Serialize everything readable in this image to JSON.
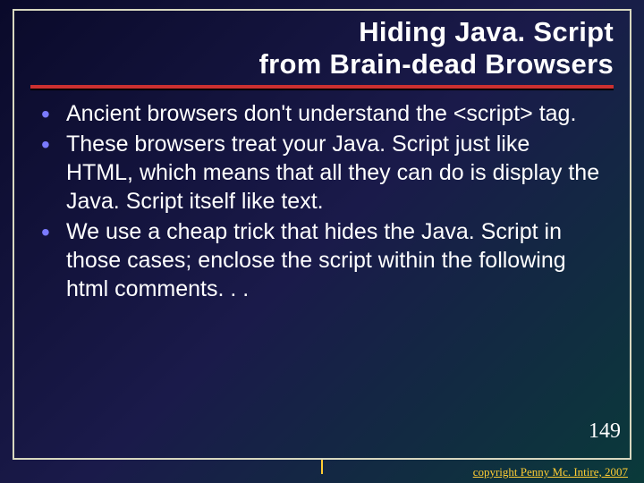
{
  "title_line1": "Hiding Java. Script",
  "title_line2": "from Brain-dead Browsers",
  "bullets": [
    {
      "pre": "Ancient browsers don't understand the ",
      "tag": "<script>",
      "post": " tag."
    },
    {
      "pre": "These browsers treat your Java. Script just like HTML, which means that all they can do is display the Java. Script itself like text.",
      "tag": "",
      "post": ""
    },
    {
      "pre": "We use a cheap trick that  hides the Java. Script in those cases; enclose the script within the following html comments. . .",
      "tag": "",
      "post": ""
    }
  ],
  "slide_number": "149",
  "copyright": "copyright Penny Mc. Intire, 2007"
}
